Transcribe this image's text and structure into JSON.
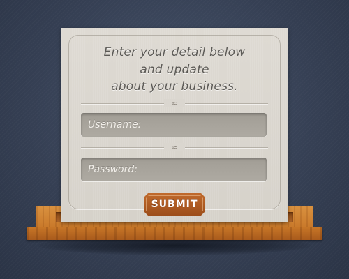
{
  "heading": {
    "line1": "Enter your detail below",
    "line2": "and update",
    "line3": "about your business."
  },
  "form": {
    "username_placeholder": "Username:",
    "password_placeholder": "Password:",
    "submit_label": "SUBMIT"
  },
  "ornament": {
    "glyph": "≈"
  },
  "colors": {
    "background": "#353f53",
    "card": "#dad6cf",
    "field": "#a9a59d",
    "button": "#ae5c22",
    "wood": "#c9792a"
  }
}
